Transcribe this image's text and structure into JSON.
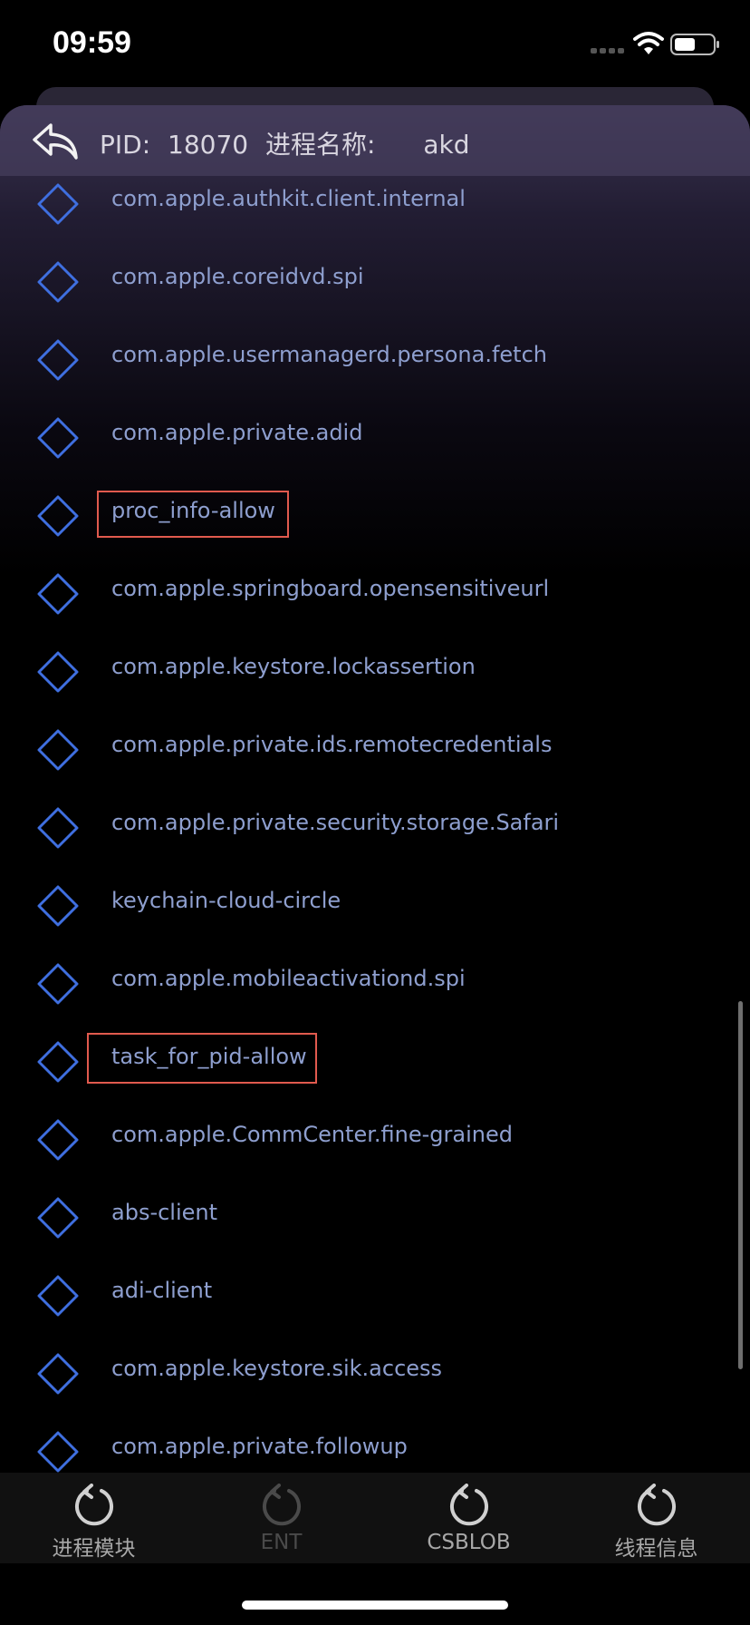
{
  "status_bar": {
    "time": "09:59"
  },
  "header": {
    "pid_label": "PID:",
    "pid_value": "18070",
    "process_name_label": "进程名称:",
    "process_name_value": "akd"
  },
  "entitlements": [
    {
      "label": "com.apple.authkit.client.internal",
      "highlighted": false
    },
    {
      "label": "com.apple.coreidvd.spi",
      "highlighted": false
    },
    {
      "label": "com.apple.usermanagerd.persona.fetch",
      "highlighted": false
    },
    {
      "label": "com.apple.private.adid",
      "highlighted": false
    },
    {
      "label": "proc_info-allow",
      "highlighted": true
    },
    {
      "label": "com.apple.springboard.opensensitiveurl",
      "highlighted": false
    },
    {
      "label": "com.apple.keystore.lockassertion",
      "highlighted": false
    },
    {
      "label": "com.apple.private.ids.remotecredentials",
      "highlighted": false
    },
    {
      "label": "com.apple.private.security.storage.Safari",
      "highlighted": false
    },
    {
      "label": "keychain-cloud-circle",
      "highlighted": false
    },
    {
      "label": "com.apple.mobileactivationd.spi",
      "highlighted": false
    },
    {
      "label": "task_for_pid-allow",
      "highlighted": true
    },
    {
      "label": "com.apple.CommCenter.fine-grained",
      "highlighted": false
    },
    {
      "label": "abs-client",
      "highlighted": false
    },
    {
      "label": "adi-client",
      "highlighted": false
    },
    {
      "label": "com.apple.keystore.sik.access",
      "highlighted": false
    },
    {
      "label": "com.apple.private.followup",
      "highlighted": false
    }
  ],
  "tab_bar": {
    "tabs": [
      {
        "label": "进程模块",
        "enabled": true
      },
      {
        "label": "ENT",
        "enabled": false
      },
      {
        "label": "CSBLOB",
        "enabled": true
      },
      {
        "label": "线程信息",
        "enabled": true
      }
    ]
  },
  "colors": {
    "item_text": "#8e9fcf",
    "diamond": "#3f6fe0",
    "highlight": "#e15a4e"
  }
}
